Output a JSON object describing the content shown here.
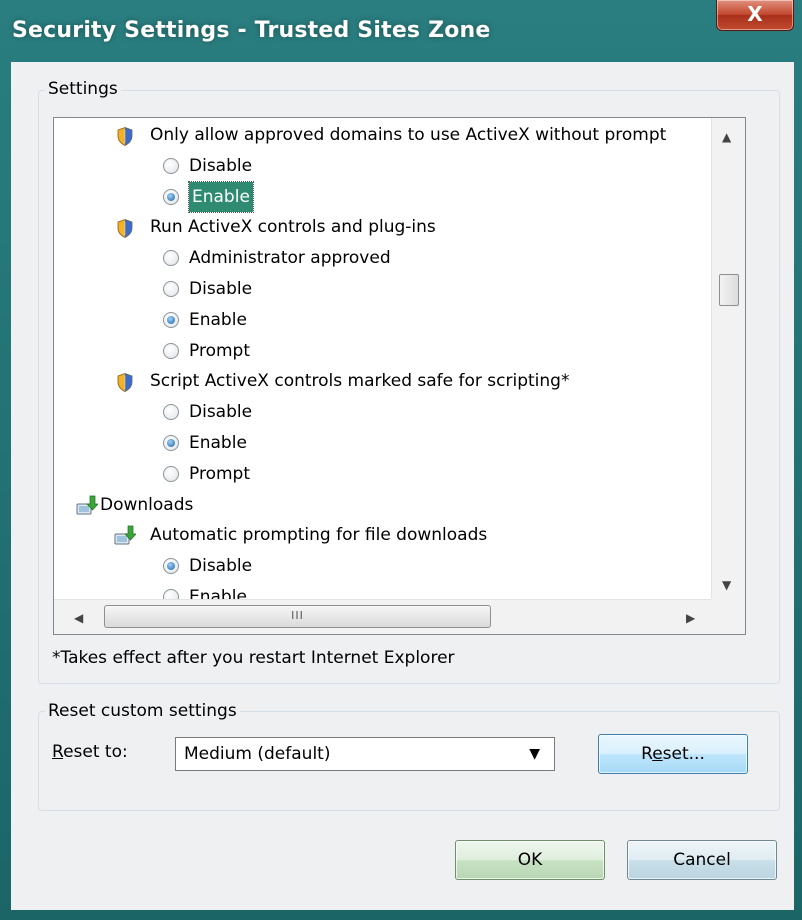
{
  "window": {
    "title": "Security Settings - Trusted Sites Zone",
    "close_label": "X"
  },
  "settings": {
    "group_label": "Settings",
    "items": [
      {
        "kind": "heading",
        "icon": "shield-icon",
        "label": "Only allow approved domains to use ActiveX without prompt"
      },
      {
        "kind": "option",
        "label": "Disable",
        "checked": false
      },
      {
        "kind": "option",
        "label": "Enable",
        "checked": true,
        "selected": true
      },
      {
        "kind": "heading",
        "icon": "shield-icon",
        "label": "Run ActiveX controls and plug-ins"
      },
      {
        "kind": "option",
        "label": "Administrator approved",
        "checked": false
      },
      {
        "kind": "option",
        "label": "Disable",
        "checked": false
      },
      {
        "kind": "option",
        "label": "Enable",
        "checked": true
      },
      {
        "kind": "option",
        "label": "Prompt",
        "checked": false
      },
      {
        "kind": "heading",
        "icon": "shield-icon",
        "label": "Script ActiveX controls marked safe for scripting*"
      },
      {
        "kind": "option",
        "label": "Disable",
        "checked": false
      },
      {
        "kind": "option",
        "label": "Enable",
        "checked": true
      },
      {
        "kind": "option",
        "label": "Prompt",
        "checked": false
      },
      {
        "kind": "category",
        "icon": "download-icon",
        "label": "Downloads"
      },
      {
        "kind": "heading",
        "icon": "download-icon",
        "label": "Automatic prompting for file downloads"
      },
      {
        "kind": "option",
        "label": "Disable",
        "checked": true
      },
      {
        "kind": "option",
        "label": "Enable",
        "checked": false
      }
    ],
    "hscroll_grip": "III",
    "note": "*Takes effect after you restart Internet Explorer"
  },
  "reset": {
    "group_label": "Reset custom settings",
    "reset_to_prefix": "R",
    "reset_to_rest": "eset to:",
    "selected_level": "Medium (default)",
    "reset_button_prefix": "R",
    "reset_button_mnemonic": "e",
    "reset_button_rest": "set..."
  },
  "footer": {
    "ok_label": "OK",
    "cancel_label": "Cancel"
  }
}
